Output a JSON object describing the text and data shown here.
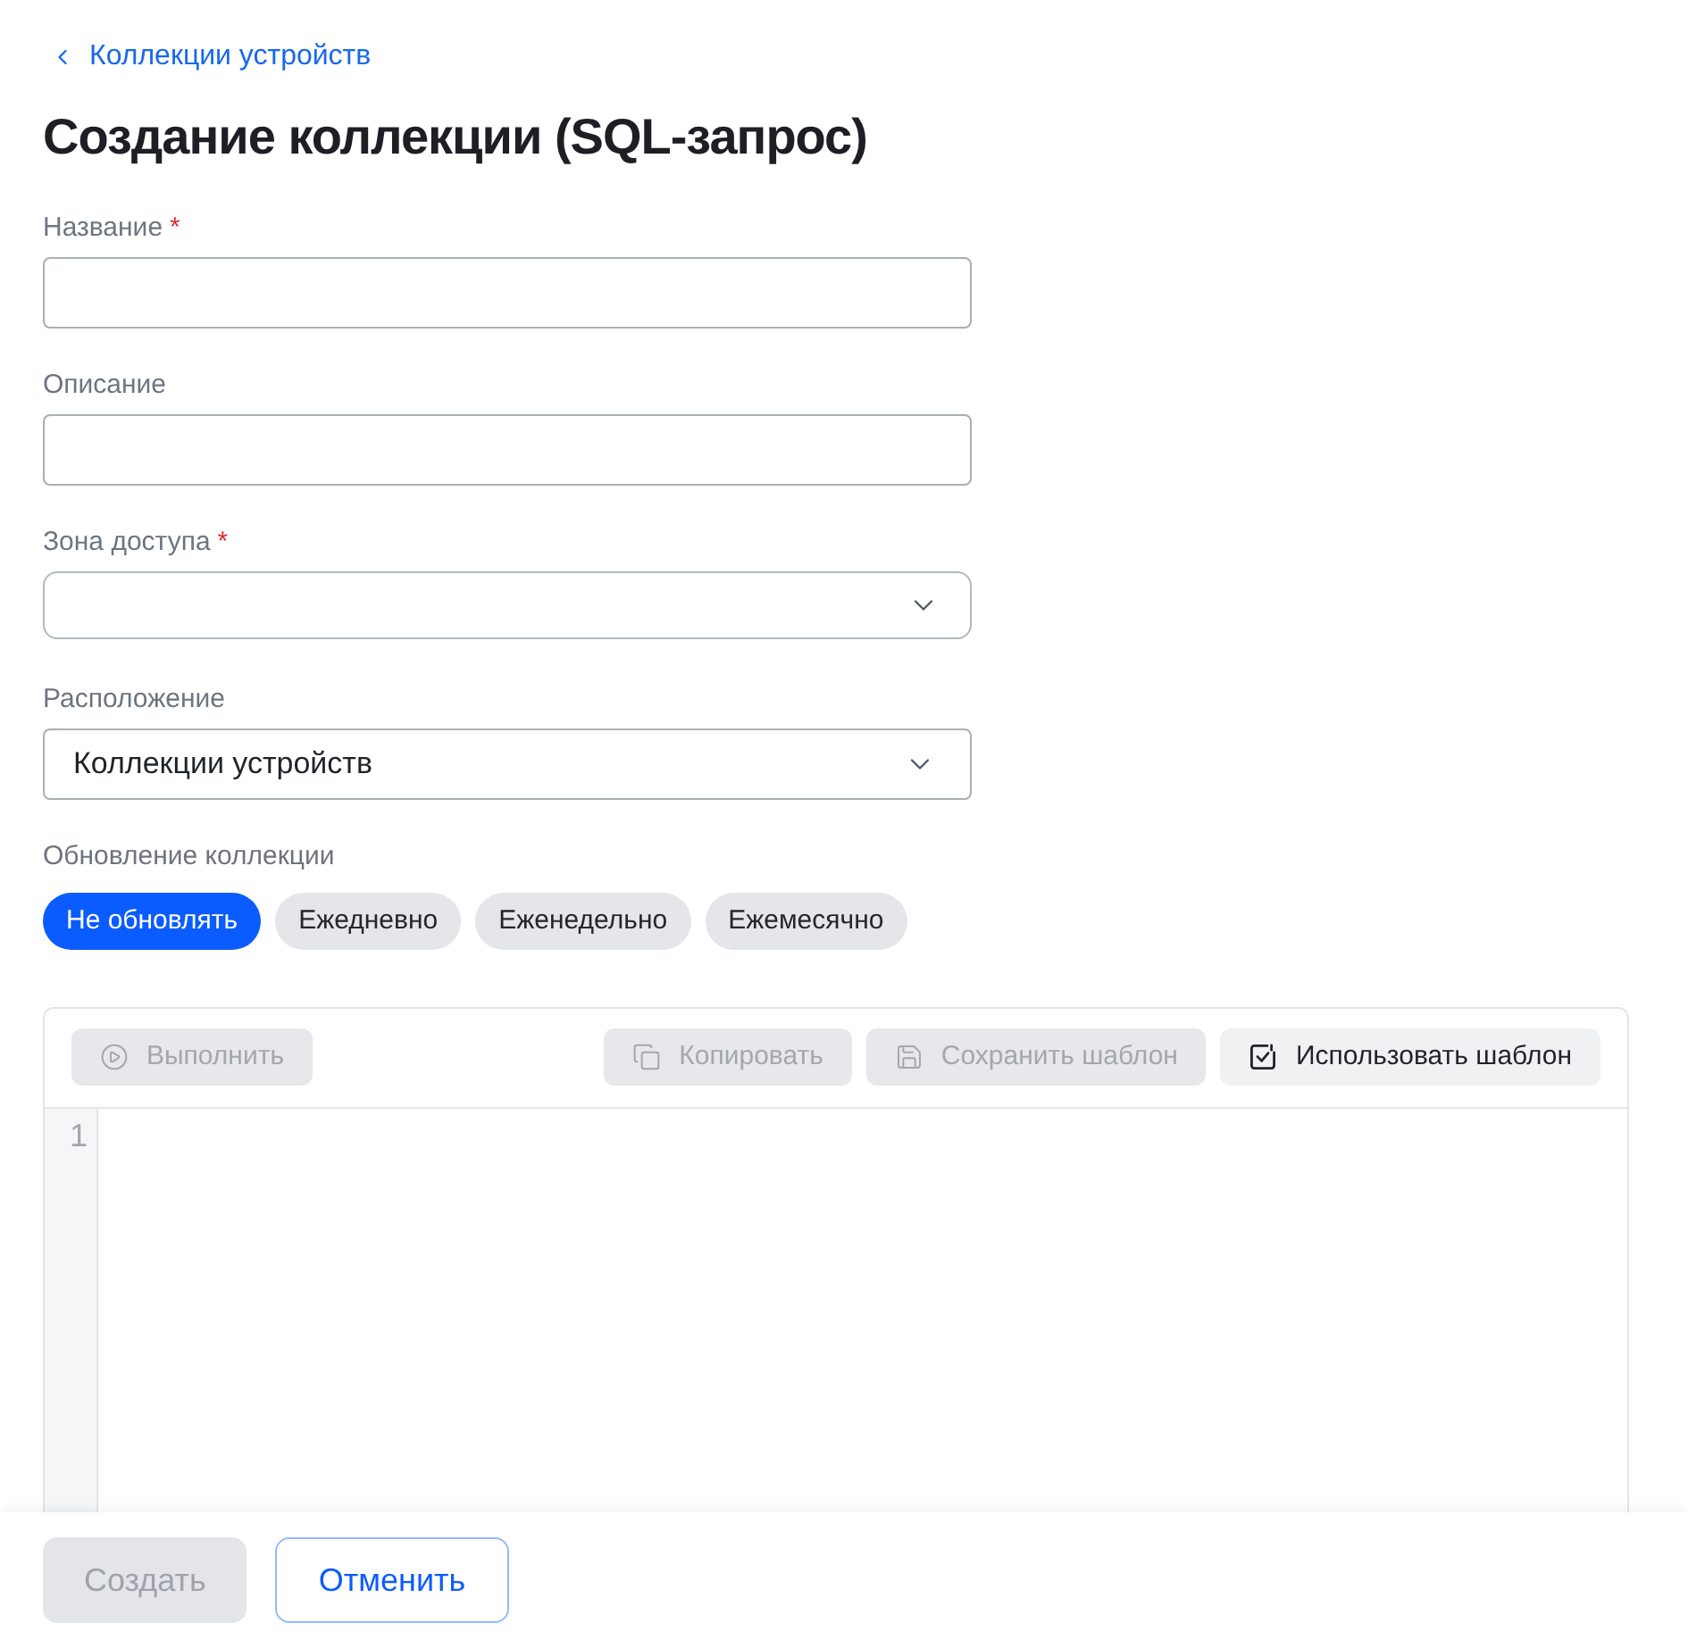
{
  "back_link": {
    "label": "Коллекции устройств"
  },
  "title": "Создание коллекции (SQL-запрос)",
  "fields": [
    {
      "kind": "text",
      "label": "Название",
      "required_mark": "*"
    },
    {
      "kind": "text",
      "label": "Описание"
    },
    {
      "kind": "combobox",
      "label": "Зона доступа",
      "required_mark": "*"
    },
    {
      "kind": "select",
      "label": "Расположение",
      "value": "Коллекции устройств"
    }
  ],
  "update": {
    "label": "Обновление коллекции",
    "options": [
      {
        "label": "Не обновлять",
        "selected": true
      },
      {
        "label": "Ежедневно",
        "selected": false
      },
      {
        "label": "Еженедельно",
        "selected": false
      },
      {
        "label": "Ежемесячно",
        "selected": false
      }
    ]
  },
  "editor": {
    "toolbar": {
      "left": [
        {
          "kind": "run",
          "label": "Выполнить",
          "disabled": true
        }
      ],
      "right": [
        {
          "kind": "copy",
          "label": "Копировать",
          "disabled": true
        },
        {
          "kind": "save",
          "label": "Сохранить шаблон",
          "disabled": true
        },
        {
          "kind": "template",
          "label": "Использовать шаблон",
          "disabled": false
        }
      ]
    },
    "line_numbers": [
      "1"
    ]
  },
  "footer": {
    "buttons": [
      {
        "kind": "primary",
        "label": "Создать",
        "disabled": true
      },
      {
        "kind": "outline",
        "label": "Отменить",
        "disabled": false
      }
    ]
  }
}
